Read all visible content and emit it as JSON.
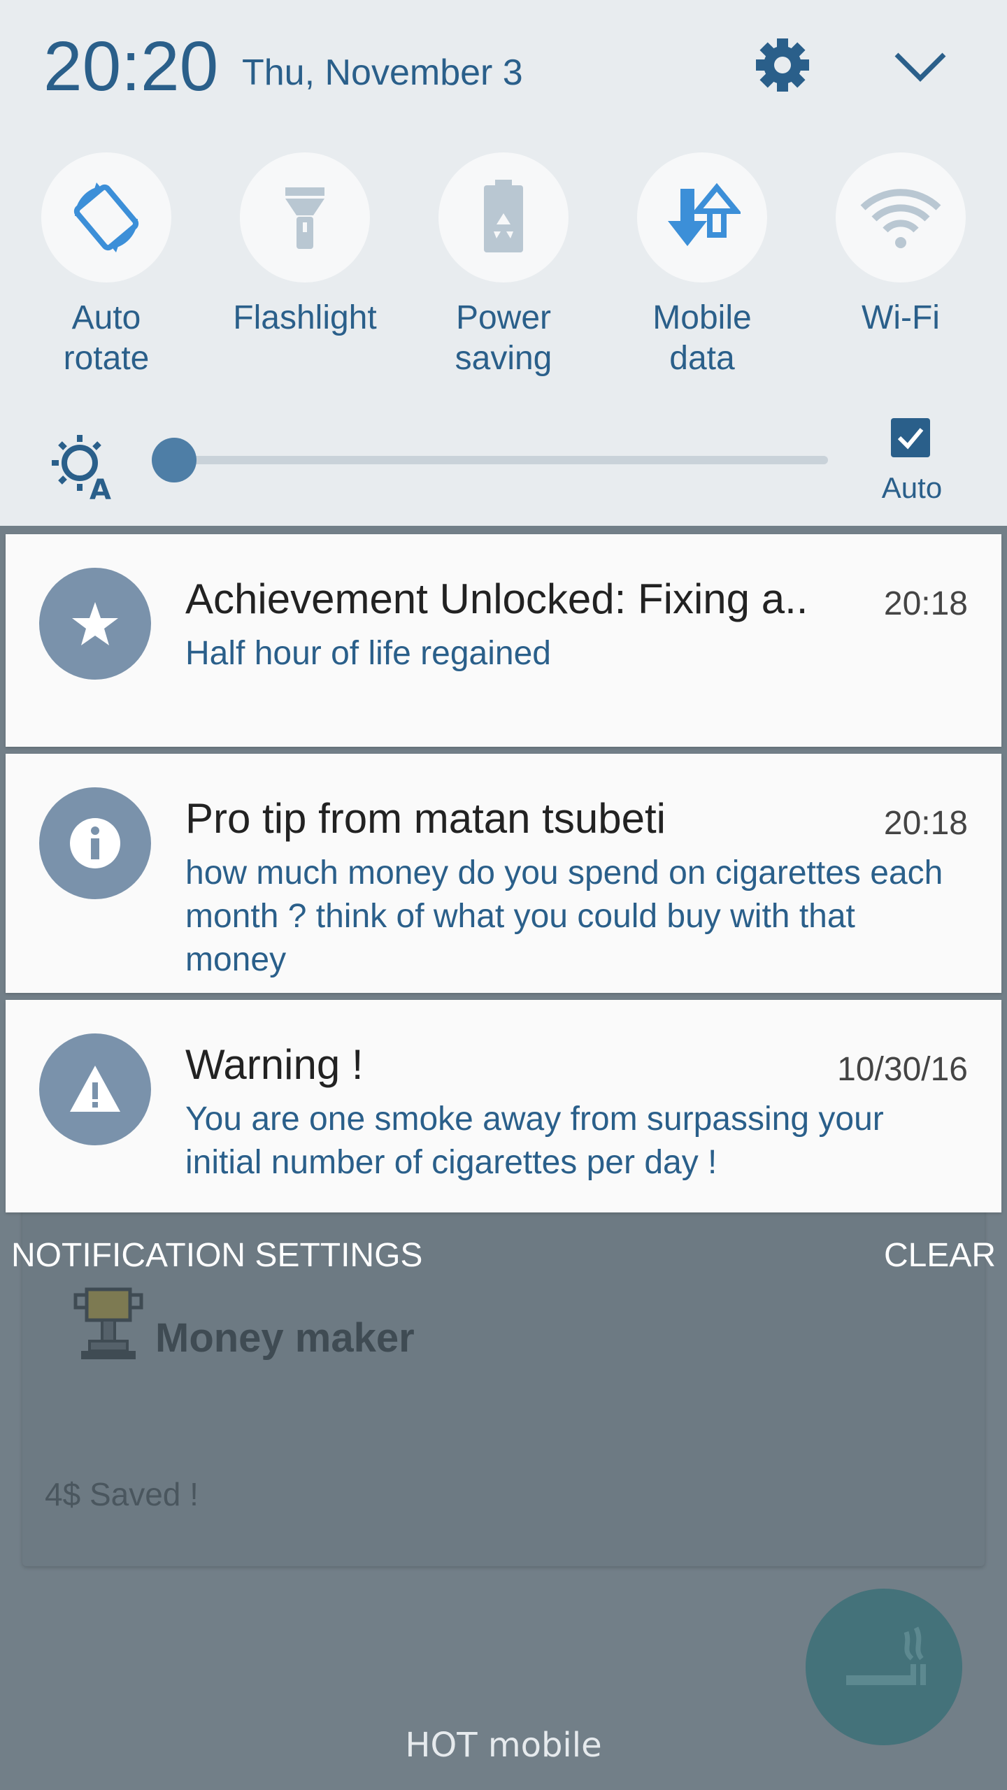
{
  "status": {
    "time": "20:20",
    "date": "Thu, November 3"
  },
  "quick_settings": [
    {
      "label_line1": "Auto",
      "label_line2": "rotate",
      "icon": "auto-rotate-icon"
    },
    {
      "label_line1": "Flashlight",
      "label_line2": "",
      "icon": "flashlight-icon"
    },
    {
      "label_line1": "Power",
      "label_line2": "saving",
      "icon": "power-saving-icon"
    },
    {
      "label_line1": "Mobile",
      "label_line2": "data",
      "icon": "mobile-data-icon"
    },
    {
      "label_line1": "Wi-Fi",
      "label_line2": "",
      "icon": "wifi-icon"
    }
  ],
  "brightness": {
    "level": 0.02,
    "auto_label": "Auto",
    "auto_checked": true
  },
  "notifications": [
    {
      "title": "Achievement Unlocked: Fixing a..",
      "time": "20:18",
      "body": "Half hour of life regained",
      "icon": "star-icon"
    },
    {
      "title": "Pro tip from matan tsubeti",
      "time": "20:18",
      "body": "how much money do you spend on cigarettes each month ? think of what you could buy with that money",
      "icon": "info-icon"
    },
    {
      "title": "Warning !",
      "time": "10/30/16",
      "body": "You are one smoke away from surpassing your initial number of cigarettes per day !",
      "icon": "warning-icon"
    }
  ],
  "footer": {
    "settings_label": "NOTIFICATION SETTINGS",
    "clear_label": "CLEAR"
  },
  "background_app": {
    "card_title": "Money maker",
    "card_sub": "4$ Saved !",
    "carrier": "HOT mobile"
  },
  "colors": {
    "accent": "#2a5f8a",
    "notif_icon_bg": "#7a92ab",
    "fab": "#44727a"
  }
}
